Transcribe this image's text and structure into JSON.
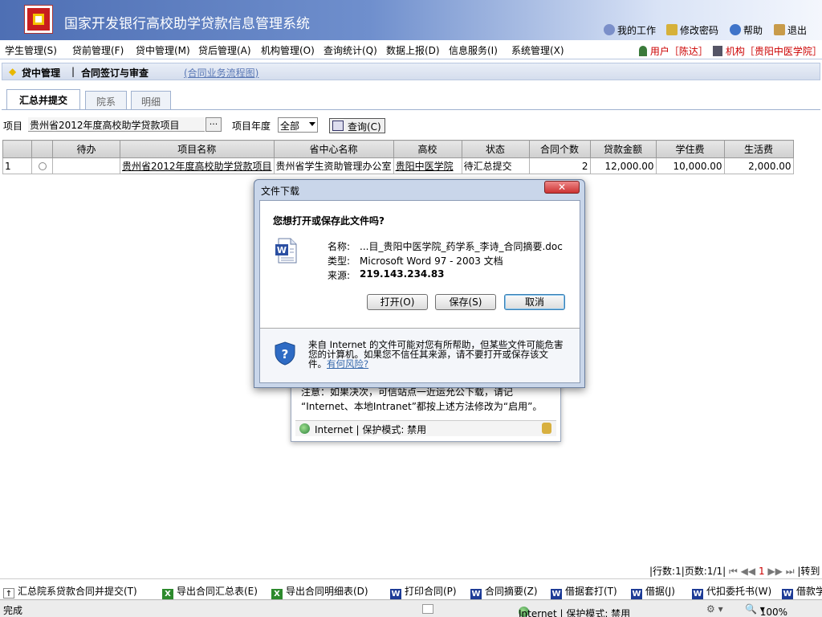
{
  "header": {
    "title": "国家开发银行高校助学贷款信息管理系统",
    "links": [
      "我的工作",
      "修改密码",
      "帮助",
      "退出"
    ]
  },
  "menu": {
    "items": [
      "学生管理(S)",
      "贷前管理(F)",
      "贷中管理(M)",
      "贷后管理(A)",
      "机构管理(O)",
      "查询统计(Q)",
      "数据上报(D)",
      "信息服务(I)",
      "系统管理(X)"
    ],
    "user": "用户［陈达］",
    "org": "机构［贵阳中医学院］"
  },
  "breadcrumb": {
    "section": "贷中管理",
    "sep": "|",
    "page": "合同签订与审查",
    "flow_link": "(合同业务流程图)"
  },
  "tabs": [
    "汇总并提交",
    "院系",
    "明细"
  ],
  "query": {
    "project_label": "项目",
    "project_value": "贵州省2012年度高校助学贷款项目",
    "browse": "···",
    "year_label": "项目年度",
    "year_value": "全部",
    "query_button": "查询(C)"
  },
  "table": {
    "headers": [
      "",
      "",
      "待办",
      "项目名称",
      "省中心名称",
      "高校",
      "状态",
      "合同个数",
      "贷款金额",
      "学住费",
      "生活费"
    ],
    "rows": [
      {
        "no": "1",
        "todo": "",
        "project": "贵州省2012年度高校助学贷款项目",
        "center": "贵州省学生资助管理办公室",
        "school": "贵阳中医学院",
        "status": "待汇总提交",
        "count": "2",
        "loan": "12,000.00",
        "tuition": "10,000.00",
        "living": "2,000.00"
      }
    ]
  },
  "behind_dialog": {
    "line1": "注意：如果决次，可信站点一近运允公下载，请记",
    "line2": "“Internet、本地Intranet”都按上述方法修改为“启用”。",
    "status": "Internet | 保护模式: 禁用"
  },
  "dialog": {
    "title": "文件下载",
    "question": "您想打开或保存此文件吗?",
    "name_label": "名称:",
    "name_value": "...目_贵阳中医学院_药学系_李诗_合同摘要.doc",
    "type_label": "类型:",
    "type_value": "Microsoft Word 97 - 2003 文档",
    "source_label": "来源:",
    "source_value": "219.143.234.83",
    "open": "打开(O)",
    "save": "保存(S)",
    "cancel": "取消",
    "warning": "来自 Internet 的文件可能对您有所帮助，但某些文件可能危害您的计算机。如果您不信任其来源，请不要打开或保存该文件。",
    "risk_link": "有何风险?"
  },
  "pager": {
    "rows": "|行数:1|页数:1/1|",
    "current_page": "1",
    "goto": "|转到"
  },
  "bottom_buttons": [
    "汇总院系贷款合同并提交(T)",
    "导出合同汇总表(E)",
    "导出合同明细表(D)",
    "打印合同(P)",
    "合同摘要(Z)",
    "借据套打(T)",
    "借据(J)",
    "代扣委托书(W)",
    "借款学"
  ],
  "statusbar": {
    "left": "完成",
    "zone": "Internet | 保护模式: 禁用",
    "zoom": "100%"
  },
  "colors": {
    "header_blue": "#4e6fb4",
    "user_red": "#cc0000",
    "link_blue": "#3366aa"
  }
}
